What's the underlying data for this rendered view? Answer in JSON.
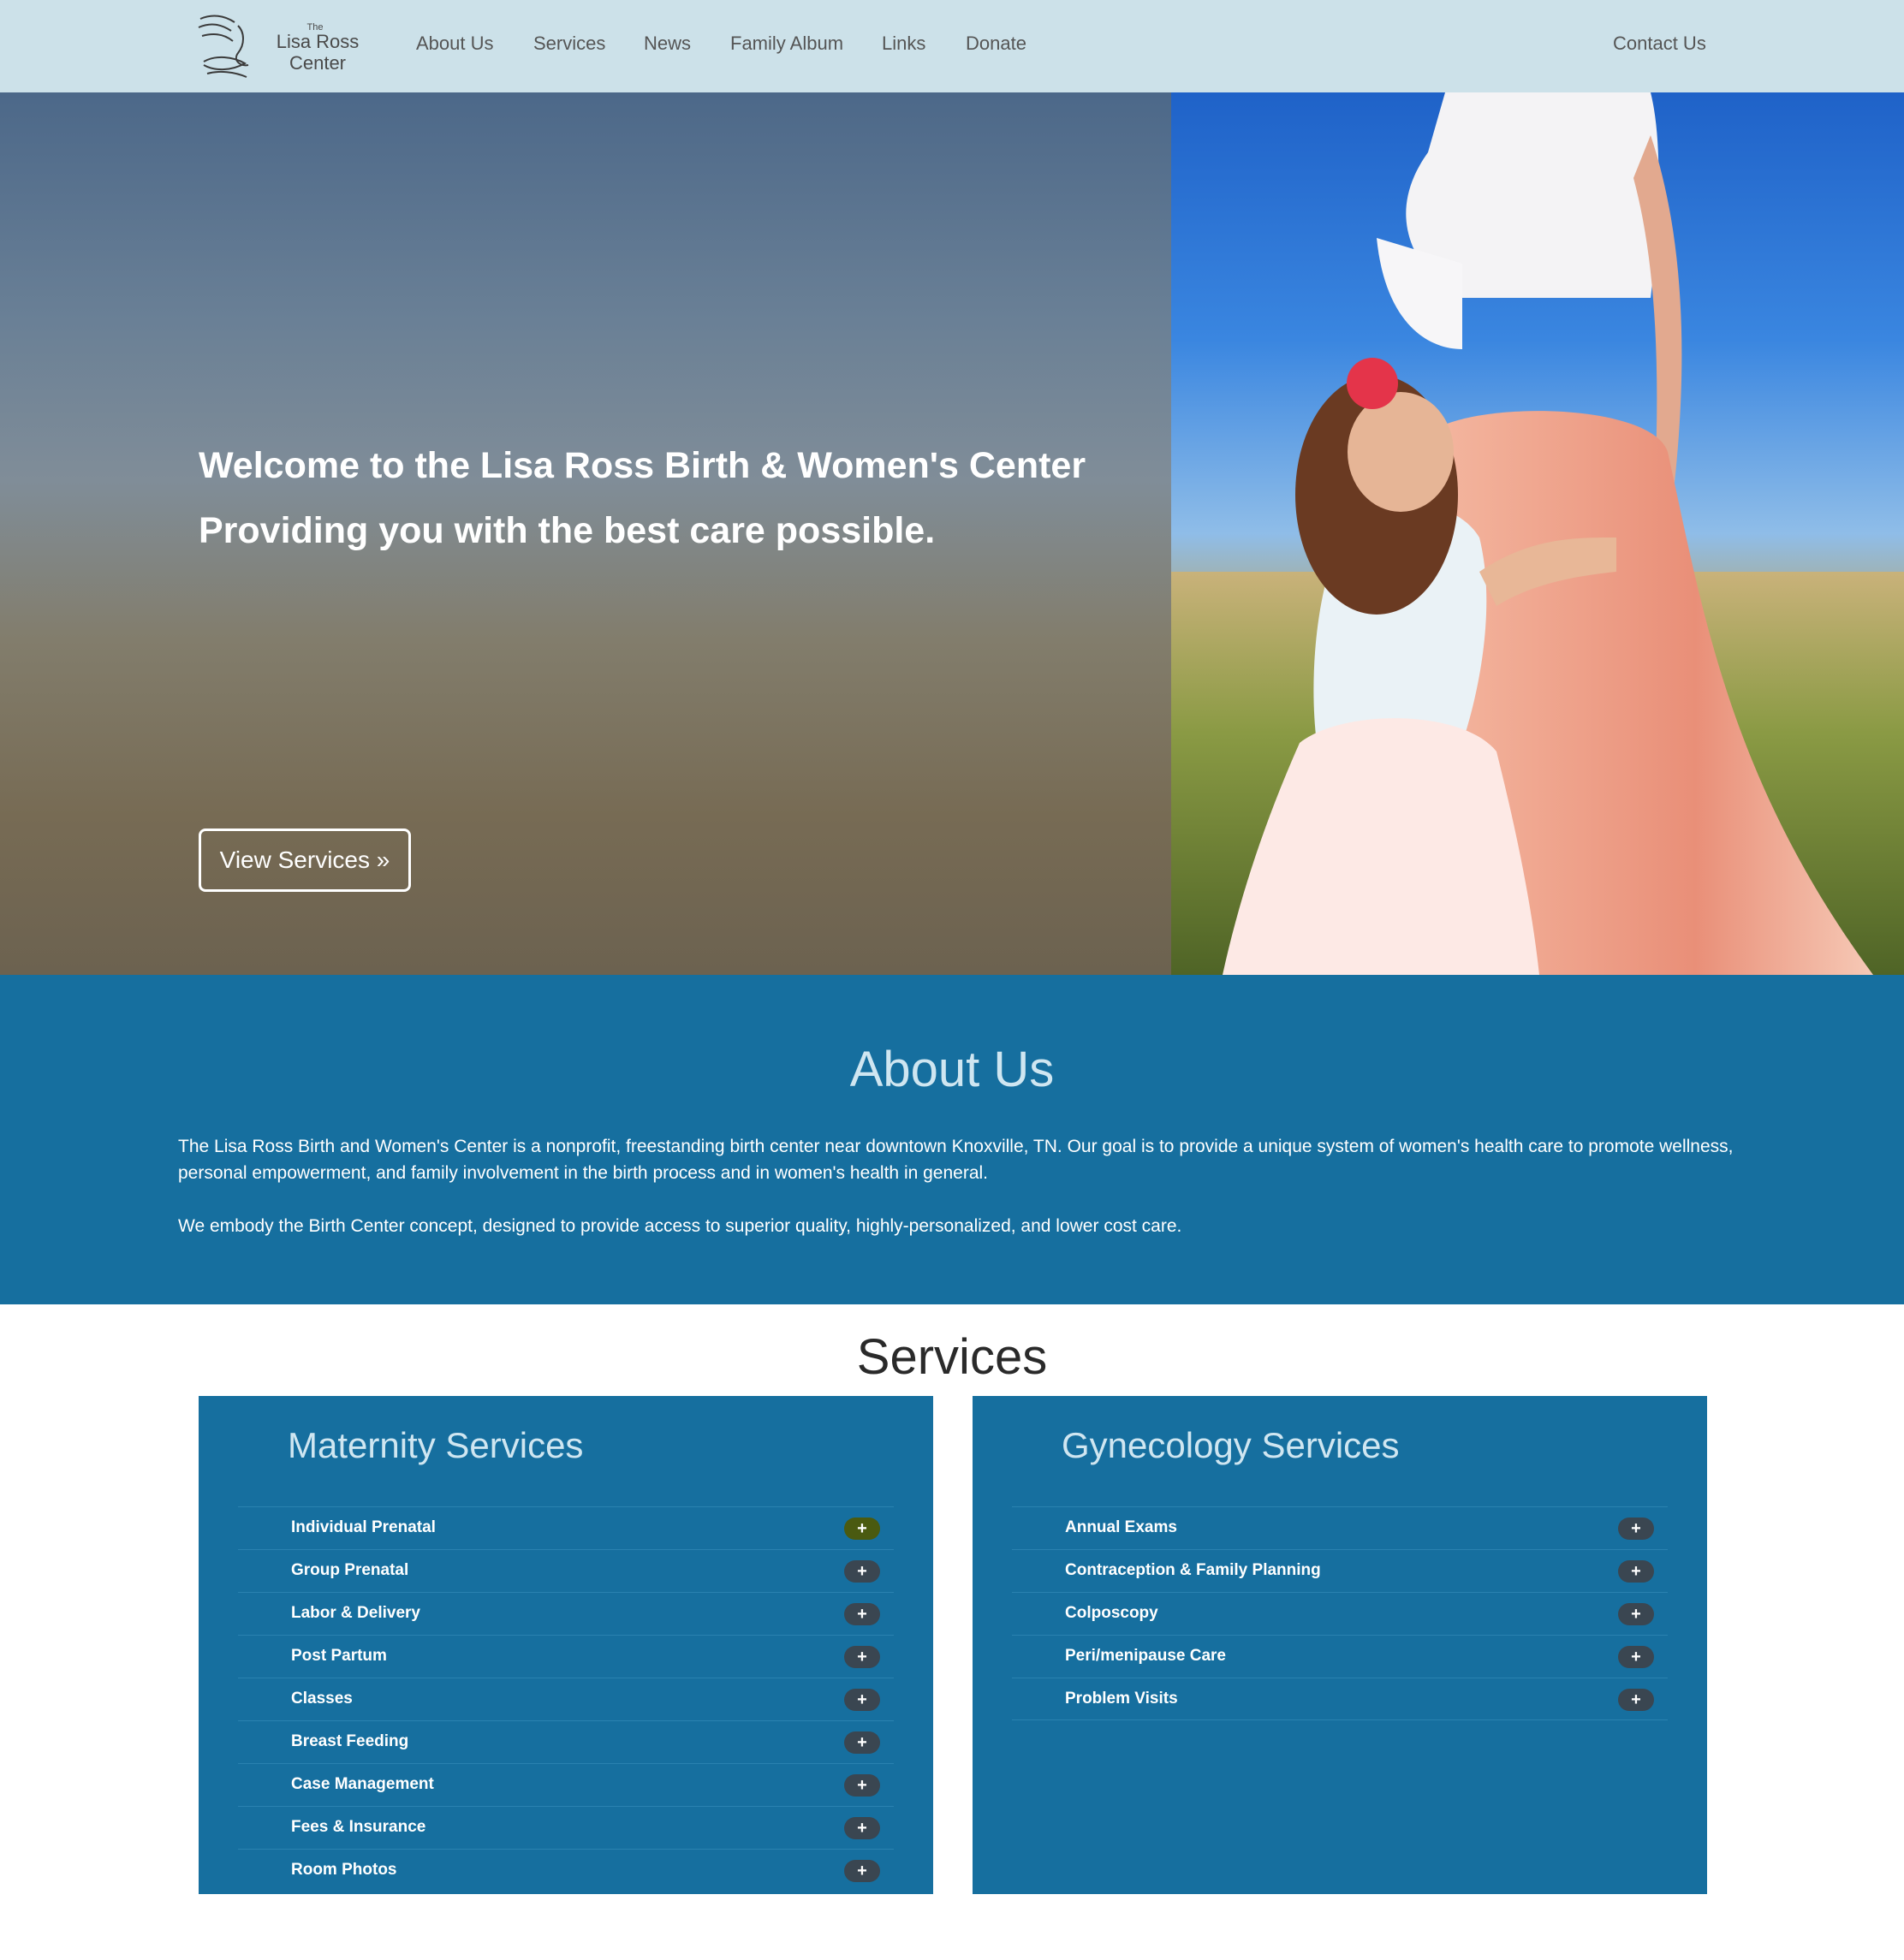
{
  "header": {
    "logo_small": "The",
    "logo_line1": "Lisa Ross",
    "logo_line2": "Center",
    "nav": [
      "About Us",
      "Services",
      "News",
      "Family Album",
      "Links",
      "Donate"
    ],
    "contact": "Contact Us"
  },
  "hero": {
    "line1": "Welcome to the Lisa Ross Birth & Women's Center",
    "line2": "Providing you with the best care possible.",
    "button": "View Services »"
  },
  "about": {
    "title": "About Us",
    "p1": "The Lisa Ross Birth and Women's Center is a nonprofit, freestanding birth center near downtown Knoxville, TN. Our goal is to provide a unique system of women's health care to promote wellness, personal empowerment, and family involvement in the birth process and in women's health in general.",
    "p2": "We embody the Birth Center concept, designed to provide access to superior quality, highly-personalized, and lower cost care."
  },
  "services": {
    "title": "Services",
    "toggle": "+",
    "maternity": {
      "title": "Maternity Services",
      "items": [
        "Individual Prenatal",
        "Group Prenatal",
        "Labor & Delivery",
        "Post Partum",
        "Classes",
        "Breast Feeding",
        "Case Management",
        "Fees & Insurance",
        "Room Photos"
      ]
    },
    "gynecology": {
      "title": "Gynecology Services",
      "items": [
        "Annual Exams",
        "Contraception & Family Planning",
        "Colposcopy",
        "Peri/menipause Care",
        "Problem Visits"
      ]
    }
  }
}
